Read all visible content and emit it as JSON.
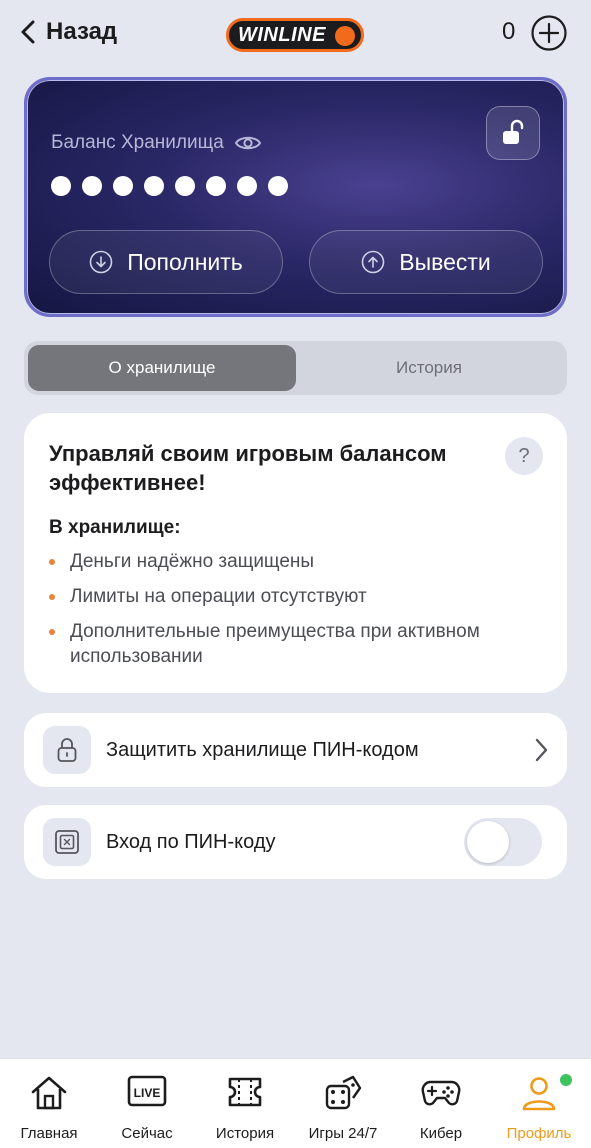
{
  "header": {
    "back_label": "Назад",
    "logo_text": "WINLINE",
    "counter": "0"
  },
  "vault": {
    "title": "Баланс Хранилища",
    "masked_dot_count": 8,
    "deposit_label": "Пополнить",
    "withdraw_label": "Вывести"
  },
  "tabs": [
    {
      "label": "О хранилище",
      "active": true
    },
    {
      "label": "История",
      "active": false
    }
  ],
  "info": {
    "title": "Управляй своим игровым балансом эффективнее!",
    "help_symbol": "?",
    "subtitle": "В хранилище:",
    "bullets": [
      "Деньги надёжно защищены",
      "Лимиты на операции отсутствуют",
      "Дополнительные преимущества при активном использовании"
    ]
  },
  "settings": {
    "pin_protect_label": "Защитить хранилище ПИН-кодом",
    "pin_login_label": "Вход по ПИН-коду",
    "pin_login_enabled": false
  },
  "nav": [
    {
      "label": "Главная",
      "icon": "home-icon"
    },
    {
      "label": "Сейчас",
      "icon": "live-icon",
      "icon_text": "LIVE"
    },
    {
      "label": "История",
      "icon": "ticket-icon"
    },
    {
      "label": "Игры 24/7",
      "icon": "dice-icon"
    },
    {
      "label": "Кибер",
      "icon": "gamepad-icon"
    },
    {
      "label": "Профиль",
      "icon": "profile-icon",
      "active": true
    }
  ],
  "colors": {
    "accent": "#f26a1b",
    "nav_active": "#f09a1b",
    "bullet": "#e8843a",
    "notification": "#3cc55c",
    "card_dark": "#2a2766"
  }
}
